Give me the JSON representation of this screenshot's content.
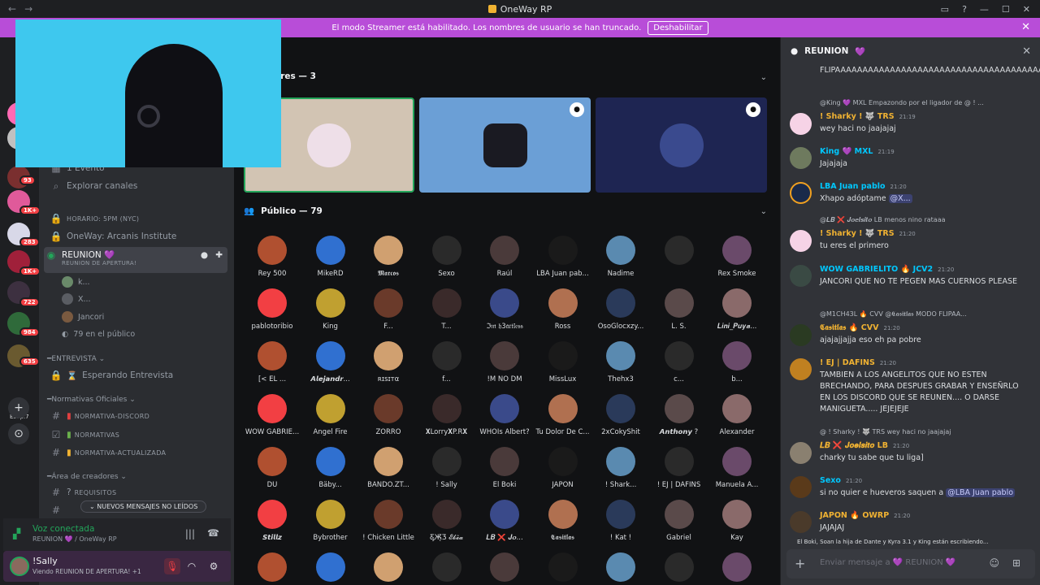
{
  "titlebar": {
    "title": "OneWay RP",
    "back": "←",
    "forward": "→"
  },
  "banner": {
    "text": "El modo Streamer está habilitado. Los nombres de usuario se han truncado.",
    "button": "Deshabilitar"
  },
  "guilds": {
    "badges": [
      "93",
      "1K+",
      "283",
      "1K+",
      "722",
      "984",
      "635"
    ],
    "label": "Esdp.7",
    "add": "+",
    "discover": "⊙"
  },
  "channels": {
    "event": "1 Evento",
    "explore": "Explorar canales",
    "horario": "HORARIO: 5PM (NYC)",
    "institute": "OneWay: Arcanis Institute",
    "reunion": {
      "name": "REUNION",
      "status": "REUNION DE APERTURA!",
      "badge": "💜"
    },
    "voice_users": [
      "k...",
      "X...",
      "Jancori"
    ],
    "public_count": "79 en el público",
    "cat_entrevista": "ENTREVISTA",
    "esperando": "Esperando Entrevista",
    "cat_normativas": "Normativas Oficiales",
    "normativa_discord": "NORMATIVA-DISCORD",
    "normativas": "NORMATIVAS",
    "normativa_actualizada": "NORMATIVA-ACTUALIZADA",
    "cat_creadores": "Área de creadores",
    "requisitos": "REQUISITOS",
    "unread": "NUEVOS MENSAJES NO LEÍDOS"
  },
  "voice": {
    "title": "Voz conectada",
    "sub": "REUNION 💜 / OneWay RP"
  },
  "user": {
    "name": "!Sally",
    "status": "Viendo REUNION DE APERTURA! +1"
  },
  "main": {
    "speakers_header": "ores — 3",
    "public_header": "Público — 79",
    "audience": [
      "Rey 500",
      "MikeRD",
      "𝕸𝖆𝖗𝖈𝖔𝖘",
      "Sexo",
      "Raúl",
      "LBA Juan pab...",
      "Nadime",
      "",
      "Rex Smoke",
      "pablotoribio",
      "King",
      "F...",
      "T...",
      "ℑ𝔪 𝔥3𝔞𝔯𝔱𝔩𝔢𝔰𝔰",
      "Ross",
      "OsoGlocxzy...",
      "L. S.",
      "𝑳𝒊𝒏𝒊_𝑷𝒖𝒚𝒂...",
      "[< EL ...",
      "𝘼𝙡𝙚𝙟𝙖𝙣𝙙𝙧...",
      "ʀɪsɪтα",
      "f...",
      "!M NO DM",
      "MissLux",
      "Thehx3",
      "c...",
      "b...",
      "WOW GABRIE...",
      "Angel Fire",
      "ZORRO",
      "𝐗Lorry𝐗P.R𝐗",
      "WHOIs Albert?",
      "Tu Dolor De C...",
      "2xCokyShit",
      "𝘼𝙣𝙩𝙝𝙤𝙣𝙮 ?",
      "Alexander",
      "DU",
      "Bäby...",
      "BANDO.ZT...",
      "! Sally",
      "El Boki",
      "JAPON",
      "! Shark...",
      "! EJ | DAFINS",
      "Manuela A...",
      "𝙎𝙩𝙞𝙡𝙡𝙯",
      "Bybrother",
      "! Chicken Little",
      "Ƹ̵̡Ӝ̵̨̄Ʒ 𝓔𝓫𝓮̃𝓪",
      "𝑳𝑩 ❌ 𝑱𝒐...",
      "𝕮𝖆𝖘𝖎𝖙𝖑𝖆𝖘",
      "! Kat !",
      "Gabriel",
      "Kay",
      "",
      "",
      "",
      "",
      "",
      "",
      "",
      "",
      ""
    ]
  },
  "chat": {
    "channel": "REUNION",
    "messages": [
      {
        "text": "FLIPAAAAAAAAAAAAAAAAAAAAAAAAAAAAAAAAAAAAAAAAAAAAAAA"
      },
      {
        "reply": "@King 💜 MXL Empazondo por el ligador de @ ! ...",
        "author": "! Sharky ! 🐺 TRS",
        "time": "21:19",
        "text": "wey haci no jaajajaj"
      },
      {
        "author": "King 💜 MXL",
        "time": "21:19",
        "text": "Jajajaja"
      },
      {
        "author": "LBA Juan pablo",
        "time": "21:20",
        "text": "Xhapo adóptame",
        "mention": "@X..."
      },
      {
        "reply": "@𝑳𝑩 ❌ 𝑱𝒐𝒆𝒍𝒔𝒊𝒕𝒐 LB menos nino rataaa",
        "author": "! Sharky ! 🐺 TRS",
        "time": "21:20",
        "text": "tu eres el primero"
      },
      {
        "author": "WOW GABRIELITO 🔥 JCV2",
        "time": "21:20",
        "text": "JANCORI  QUE NO TE PEGEN MAS CUERNOS PLEASE"
      },
      {
        "reply": "@M1CH43L 🔥 CVV @𝕮𝖆𝖘𝖎𝖙𝖑𝖆𝖘 MODO FLIPAA...",
        "author": "𝕮𝖆𝖘𝖎𝖙𝖑𝖆𝖘 🔥 CVV",
        "time": "21:20",
        "text": "ajajajjajja eso eh pa pobre"
      },
      {
        "author": "! EJ | DAFINS",
        "time": "21:20",
        "text": "TAMBIEN A LOS ANGELITOS QUE NO ESTEN BRECHANDO, PARA DESPUES GRABAR Y ENSEÑRLO EN LOS DISCORD QUE SE REUNEN.... O DARSE MANIGUETA..... JEJEJEJE"
      },
      {
        "reply": "@ ! Sharky ! 🐺 TRS wey haci no jaajajaj",
        "author": "𝑳𝑩 ❌ 𝑱𝒐𝒆𝒍𝒔𝒊𝒕𝒐 LB",
        "time": "21:20",
        "text": "charky tu sabe que tu liga]"
      },
      {
        "author": "Sexo",
        "time": "21:20",
        "text": "si no quier e hueveros saquen a",
        "mention": "@LBA Juan pablo"
      },
      {
        "author": "JAPON 🔥 OWRP",
        "time": "21:20",
        "text": "JAJAJAJ"
      }
    ],
    "typing": "El Boki, Soan la hija de Dante y Kyra 3.1 y King están escribiendo...",
    "placeholder": "Enviar mensaje a 💜 REUNION 💜"
  },
  "colors": {
    "accent": "#b84dd8",
    "green": "#23a55a",
    "bg": "#111214",
    "chatbg": "#313338"
  }
}
